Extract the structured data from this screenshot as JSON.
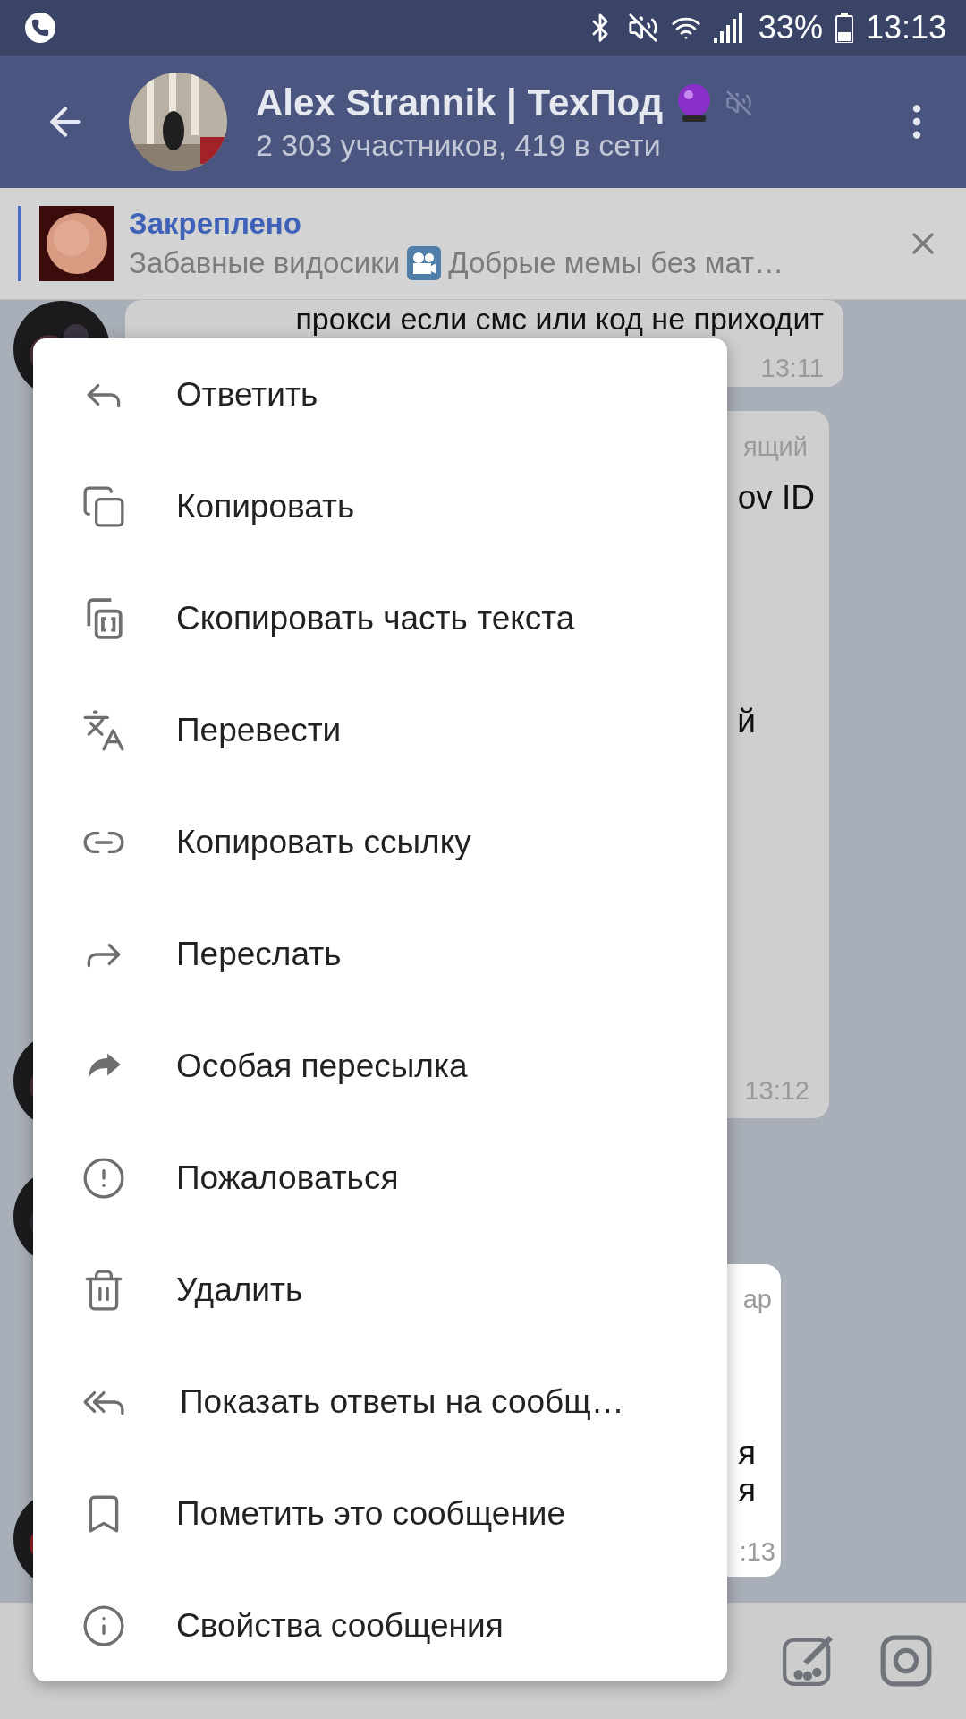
{
  "status_bar": {
    "battery": "33%",
    "time": "13:13"
  },
  "header": {
    "title": "Alex Strannik | ТехПод",
    "subtitle": "2 303 участников, 419 в сети"
  },
  "pinned": {
    "label": "Закреплено",
    "preview_start": "Забавные видосики",
    "preview_end": "Добрые мемы без мат…"
  },
  "messages": [
    {
      "highlighted": false,
      "lines": [
        {
          "kind": "text",
          "text": "прокси если смс или код не приходит"
        }
      ],
      "time": "13:11"
    },
    {
      "highlighted": false,
      "lines": [
        {
          "kind": "sender",
          "text": "ящий"
        },
        {
          "kind": "text",
          "text": "ov ID"
        },
        {
          "kind": "text",
          "text": "й"
        }
      ],
      "time": "13:12"
    },
    {
      "highlighted": true,
      "lines": [
        {
          "kind": "sender",
          "text": "ар"
        },
        {
          "kind": "text",
          "text": "я"
        },
        {
          "kind": "text",
          "text": "я"
        }
      ],
      "time": ":13"
    }
  ],
  "menu": {
    "items": [
      "Ответить",
      "Копировать",
      "Скопировать часть текста",
      "Перевести",
      "Копировать ссылку",
      "Переслать",
      "Особая пересылка",
      "Пожаловаться",
      "Удалить",
      "Показать ответы на сообщ…",
      "Пометить это сообщение",
      "Свойства сообщения"
    ]
  }
}
